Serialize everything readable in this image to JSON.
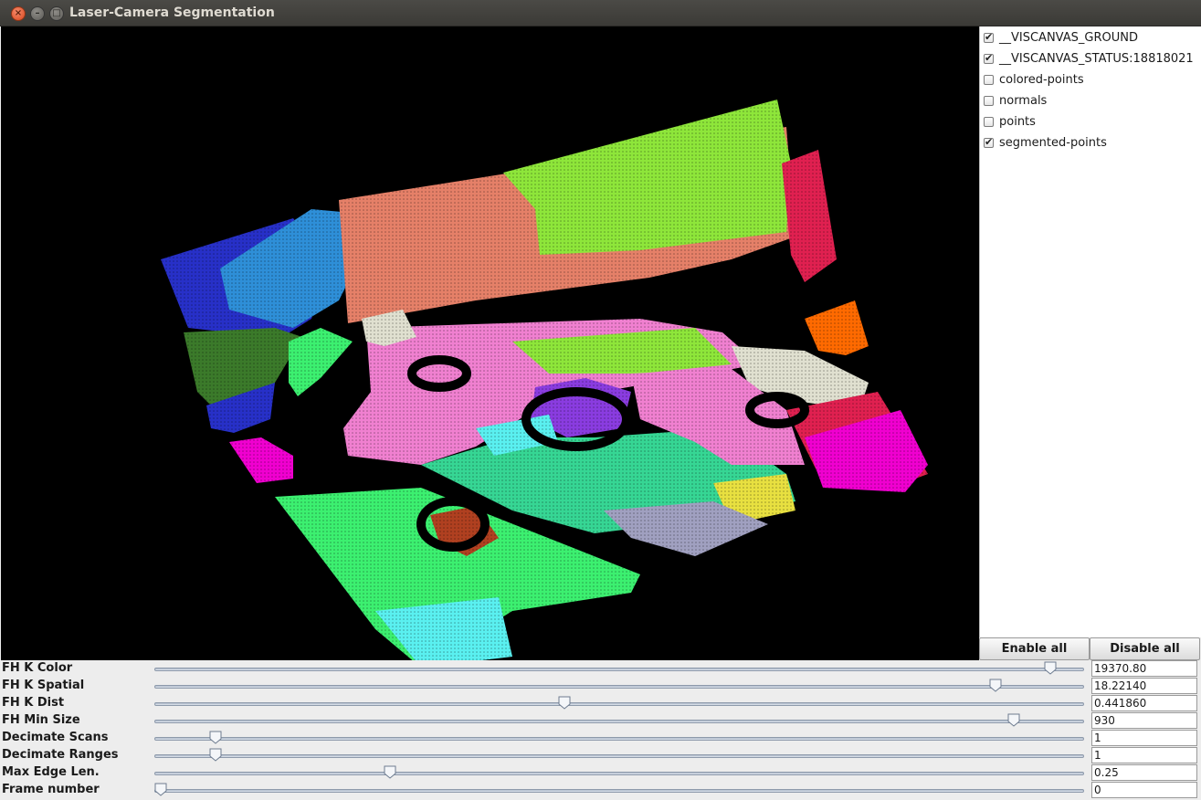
{
  "window": {
    "title": "Laser-Camera Segmentation"
  },
  "layers": [
    {
      "label": "__VISCANVAS_GROUND",
      "checked": true
    },
    {
      "label": "__VISCANVAS_STATUS:18818021",
      "checked": true
    },
    {
      "label": "colored-points",
      "checked": false
    },
    {
      "label": "normals",
      "checked": false
    },
    {
      "label": "points",
      "checked": false
    },
    {
      "label": "segmented-points",
      "checked": true
    }
  ],
  "buttons": {
    "enable_all": "Enable all",
    "disable_all": "Disable all"
  },
  "params": [
    {
      "label": "FH K Color",
      "value": "19370.80",
      "position": 0.97
    },
    {
      "label": "FH K Spatial",
      "value": "18.22140",
      "position": 0.91
    },
    {
      "label": "FH K Dist",
      "value": "0.441860",
      "position": 0.44
    },
    {
      "label": "FH Min Size",
      "value": "930",
      "position": 0.93
    },
    {
      "label": "Decimate Scans",
      "value": "1",
      "position": 0.06
    },
    {
      "label": "Decimate Ranges",
      "value": "1",
      "position": 0.06
    },
    {
      "label": "Max Edge Len.",
      "value": "0.25",
      "position": 0.25
    },
    {
      "label": "Frame number",
      "value": "0",
      "position": 0.0
    }
  ],
  "colors": {
    "canvas_bg": "#000000",
    "segments": [
      "#8ee63a",
      "#e58068",
      "#2730c8",
      "#2e8fd8",
      "#3b7a2a",
      "#f080d0",
      "#36d694",
      "#8a3ce0",
      "#e0e0d0",
      "#5af0f0",
      "#f000d0",
      "#ff6a00",
      "#3cf070",
      "#b04020",
      "#a0a0c0",
      "#e8e040",
      "#e02050"
    ]
  }
}
